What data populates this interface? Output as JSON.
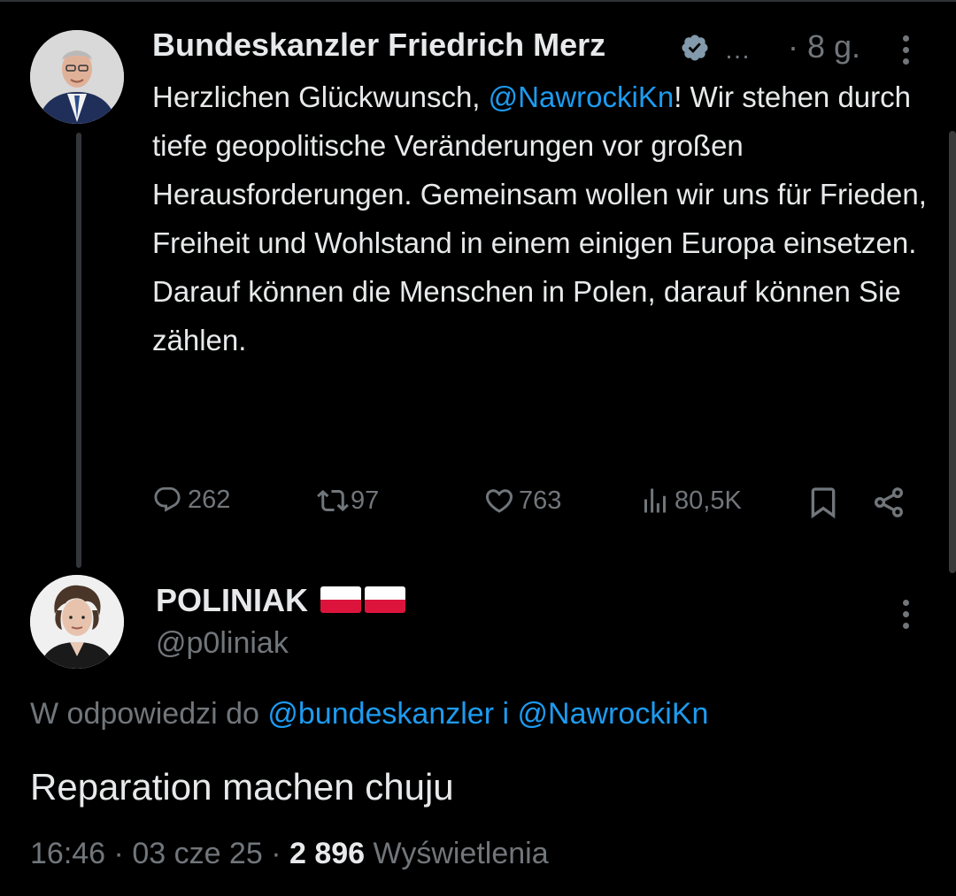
{
  "post": {
    "author_name": "Bundeskanzler Friedrich Merz",
    "more_glyph": "…",
    "time": "8 g.",
    "text_prefix": "Herzlichen Glückwunsch, ",
    "mention": "@NawrockiKn",
    "text_rest": "! Wir stehen durch tiefe geopolitische Veränderungen vor großen Herausforderungen. Gemeinsam wollen wir uns für Frieden, Freiheit und Wohlstand in einem einigen Europa einsetzen. Darauf können die Menschen in Polen, darauf können Sie zählen.",
    "replies": "262",
    "reposts": "97",
    "likes": "763",
    "views": "80,5K",
    "verified_color": "#829aab"
  },
  "reply": {
    "author_name": "POLINIAK",
    "handle": "@p0liniak",
    "reply_to_label": "W odpowiedzi do",
    "reply_to_user1": "@bundeskanzler",
    "reply_to_conj": "i",
    "reply_to_user2": "@NawrockiKn",
    "text": "Reparation machen chuju",
    "time": "16:46",
    "date": "03 cze 25",
    "views_count": "2 896",
    "views_label": "Wyświetlenia"
  },
  "colors": {
    "accent": "#1d9bf0",
    "muted": "#71767b",
    "text": "#e7e9ea",
    "background": "#000000"
  },
  "icons": [
    "reply-icon",
    "repost-icon",
    "like-icon",
    "views-icon",
    "bookmark-icon",
    "share-icon",
    "verified-badge-icon",
    "more-vertical-icon",
    "poland-flag-icon"
  ]
}
